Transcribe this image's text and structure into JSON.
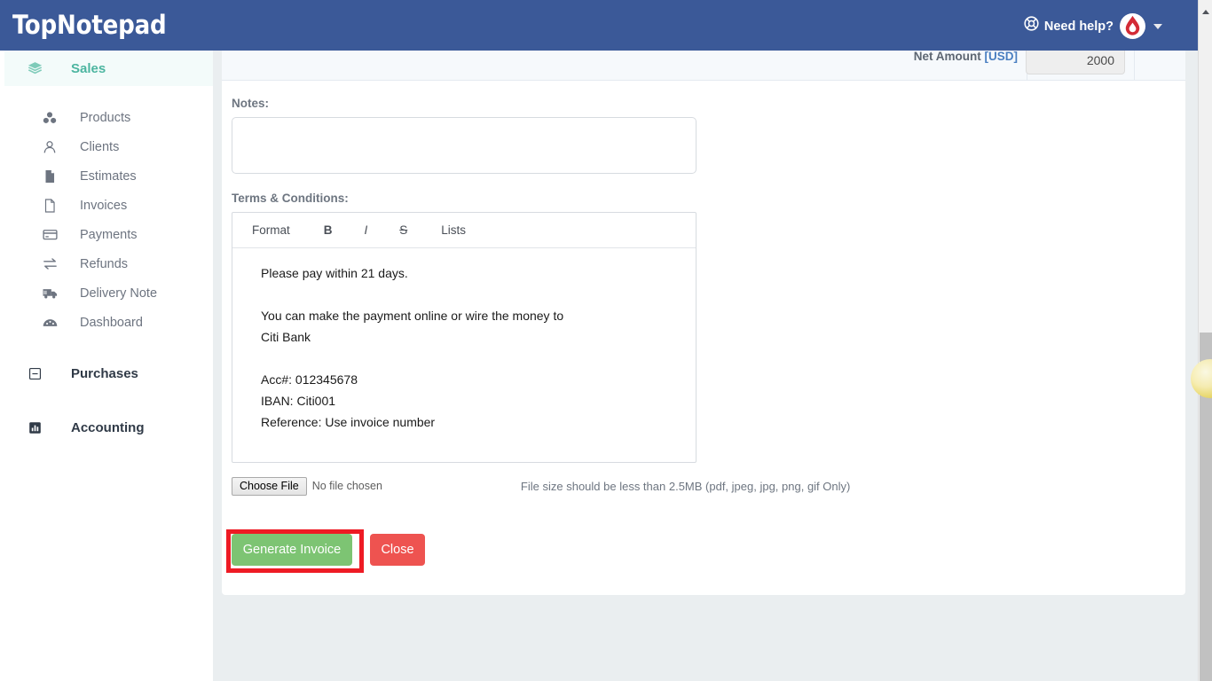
{
  "header": {
    "logo_top": "Top",
    "logo_note": "Notepad",
    "help_label": "Need help?",
    "help_icon": "lifebuoy-icon",
    "avatar_icon": "user-avatar-logo",
    "caret_icon": "chevron-down-icon",
    "background_color": "#3b5998"
  },
  "sidebar": {
    "groups": [
      {
        "label": "Sales",
        "icon": "layers-icon",
        "active": true,
        "accent_color": "#4cb5a0",
        "items": [
          {
            "label": "Products",
            "icon": "products-icon"
          },
          {
            "label": "Clients",
            "icon": "clients-icon"
          },
          {
            "label": "Estimates",
            "icon": "estimates-document-icon"
          },
          {
            "label": "Invoices",
            "icon": "invoice-document-icon"
          },
          {
            "label": "Payments",
            "icon": "credit-card-icon"
          },
          {
            "label": "Refunds",
            "icon": "exchange-arrows-icon"
          },
          {
            "label": "Delivery Note",
            "icon": "truck-icon"
          },
          {
            "label": "Dashboard",
            "icon": "dashboard-gauge-icon"
          }
        ]
      },
      {
        "label": "Purchases",
        "icon": "minus-square-icon",
        "active": false,
        "items": []
      },
      {
        "label": "Accounting",
        "icon": "bar-chart-icon",
        "active": false,
        "items": []
      }
    ]
  },
  "main": {
    "total_row": {
      "label": "Net Amount ",
      "currency": "[USD]",
      "value": "2000"
    },
    "notes": {
      "label": "Notes:",
      "value": "",
      "placeholder": ""
    },
    "terms": {
      "label": "Terms & Conditions:",
      "toolbar": {
        "format": "Format",
        "bold": "B",
        "italic": "I",
        "strike": "S",
        "lists": "Lists"
      },
      "lines": [
        "Please pay within 21 days.",
        "You can make the payment online or wire the money to",
        "Citi Bank",
        "Acc#: 012345678",
        "IBAN: Citi001",
        "Reference: Use invoice number"
      ]
    },
    "upload": {
      "button_label": "Choose File",
      "file_status": "No file chosen",
      "hint": "File size should be less than 2.5MB (pdf, jpeg, jpg, png, gif Only)"
    },
    "actions": {
      "generate_label": "Generate Invoice",
      "generate_color": "#7dc473",
      "close_label": "Close",
      "close_color": "#ee5350",
      "highlight_color": "#ee1b24"
    }
  },
  "scrollbar": {
    "up_arrow_icon": "scroll-up-arrow-icon"
  }
}
